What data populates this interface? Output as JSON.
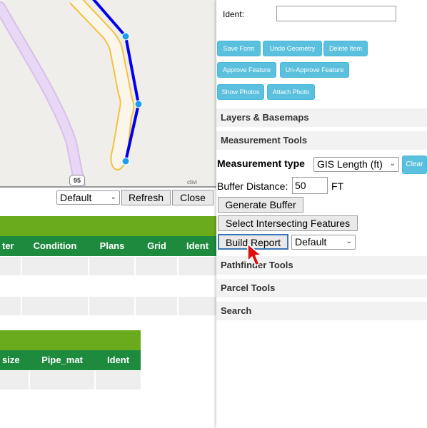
{
  "map": {
    "route_shield": "95",
    "attribution": "ctivi"
  },
  "lower_panel": {
    "select_value": "Default",
    "refresh_label": "Refresh",
    "close_label": "Close"
  },
  "table1": {
    "columns": [
      "ter",
      "Condition",
      "Plans",
      "Grid",
      "Ident"
    ]
  },
  "table2": {
    "columns": [
      "size",
      "Pipe_mat",
      "Ident"
    ]
  },
  "right_panel": {
    "ident_label": "Ident:",
    "ident_value": "",
    "buttons": {
      "save_form": "Save Form",
      "undo_geometry": "Undo Geometry",
      "delete_item": "Delete Item",
      "approve_feature": "Approve Feature",
      "unapprove_feature": "Un-Approve Feature",
      "show_photos": "Show Photos",
      "attach_photo": "Attach Photo"
    },
    "sections": {
      "layers": "Layers & Basemaps",
      "measurement": "Measurement Tools",
      "pathfinder": "Pathfinder Tools",
      "parcel": "Parcel Tools",
      "search": "Search"
    },
    "measurement": {
      "type_label": "Measurement type",
      "type_value": "GIS Length (ft)",
      "clear_label": "Clear",
      "buffer_label": "Buffer Distance:",
      "buffer_value": "50",
      "buffer_unit": "FT",
      "generate_buffer": "Generate Buffer",
      "select_intersecting": "Select Intersecting Features",
      "build_report": "Build Report",
      "report_select_value": "Default"
    }
  },
  "colors": {
    "table_title_green": "#6aab1e",
    "table_header_green": "#1e8a3e",
    "button_blue": "#5bc0de",
    "line_blue": "#0000ee",
    "buffer_orange": "#f5c040",
    "road_purple": "#e3cdf2"
  }
}
